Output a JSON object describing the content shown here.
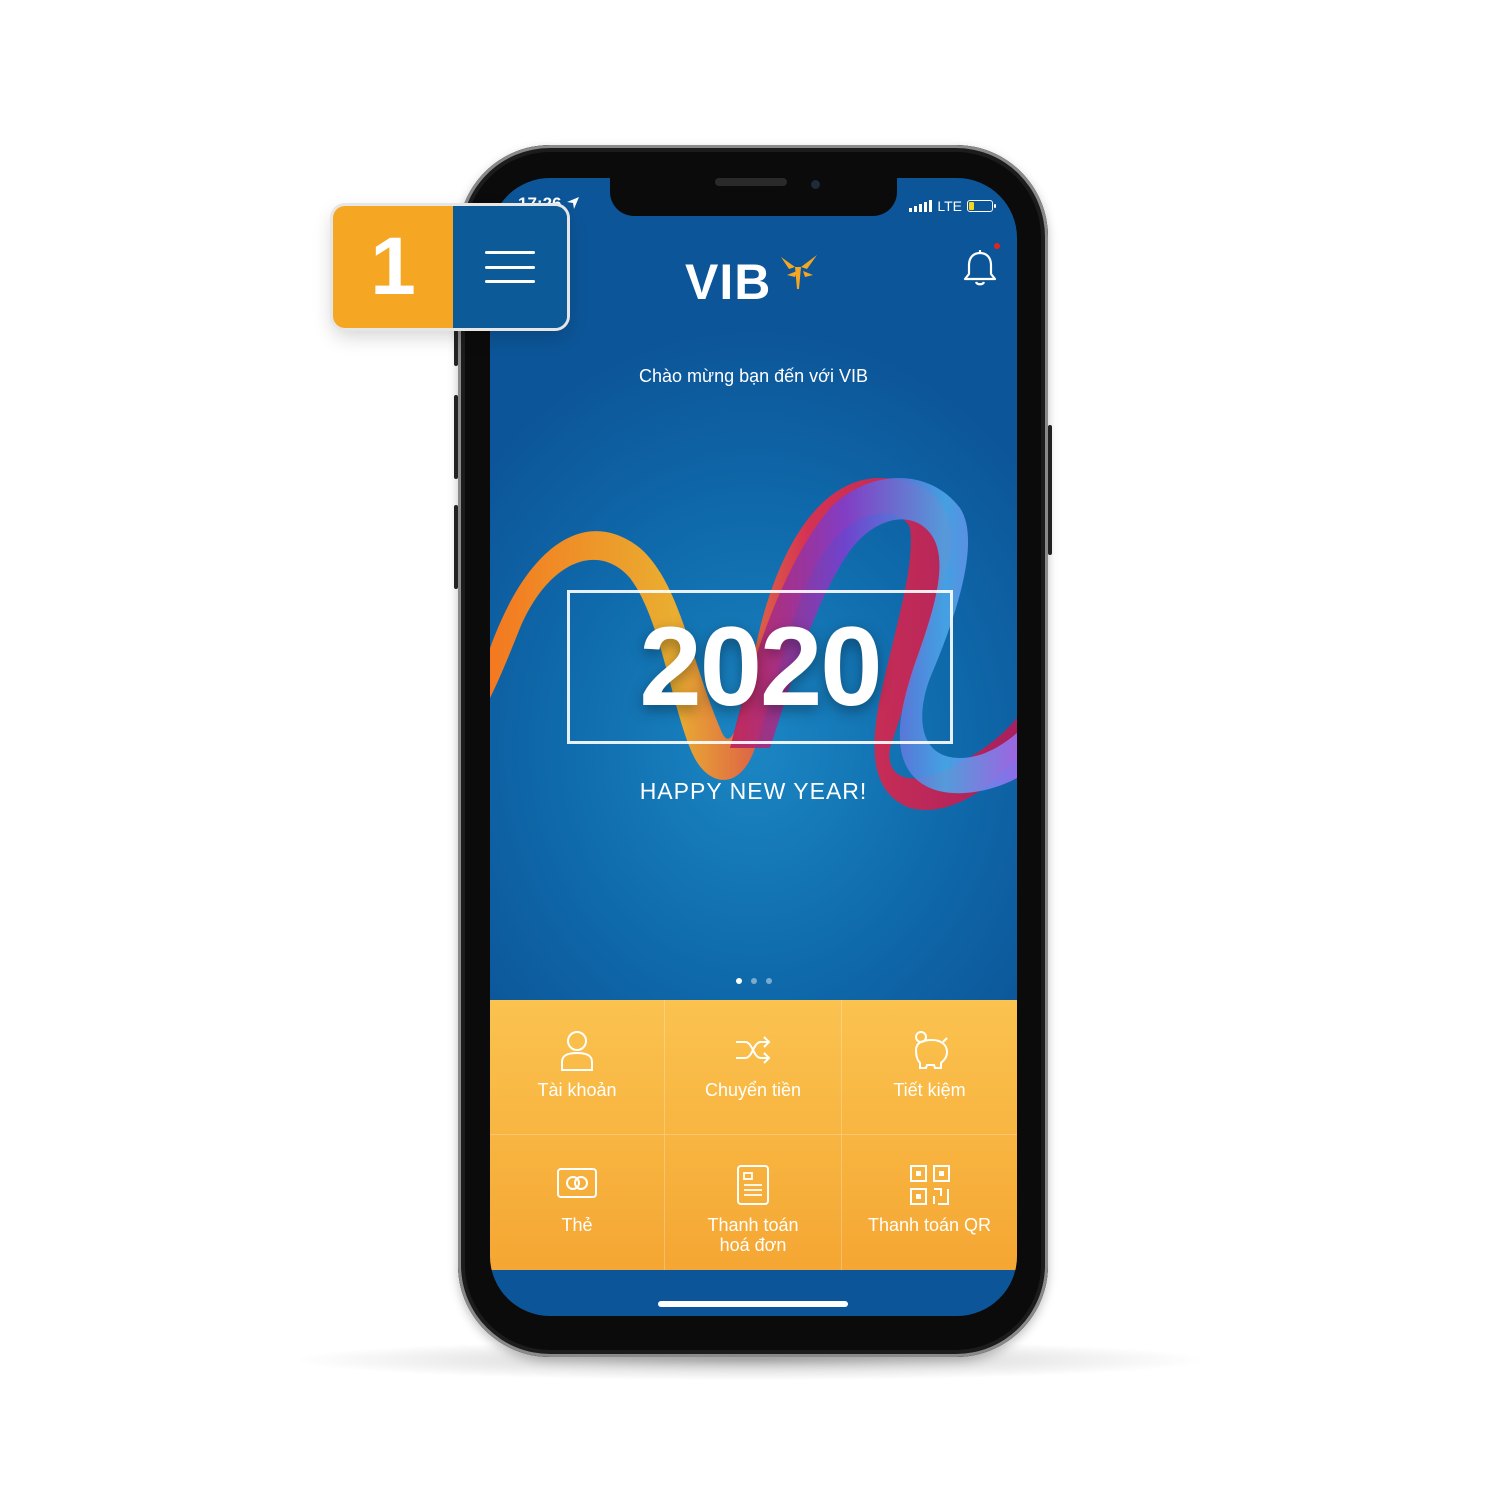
{
  "status_bar": {
    "time": "17:26",
    "network": "LTE"
  },
  "header": {
    "logo": "VIB",
    "welcome": "Chào mừng bạn đến với VIB"
  },
  "banner": {
    "year": "2020",
    "greeting": "HAPPY NEW YEAR!",
    "slide_count": 3,
    "active_slide": 1
  },
  "menu": {
    "items": [
      {
        "label": "Tài khoản",
        "icon": "account-icon"
      },
      {
        "label": "Chuyển tiền",
        "icon": "transfer-icon"
      },
      {
        "label": "Tiết kiệm",
        "icon": "savings-icon"
      },
      {
        "label": "Thẻ",
        "icon": "card-icon"
      },
      {
        "label": "Thanh toán\nhoá đơn",
        "icon": "bill-icon"
      },
      {
        "label": "Thanh toán QR",
        "icon": "qr-icon"
      }
    ]
  },
  "callout": {
    "step": "1"
  },
  "colors": {
    "primary_blue": "#0f6aab",
    "accent_orange": "#f5a623",
    "tile_yellow": "#f8b541"
  }
}
